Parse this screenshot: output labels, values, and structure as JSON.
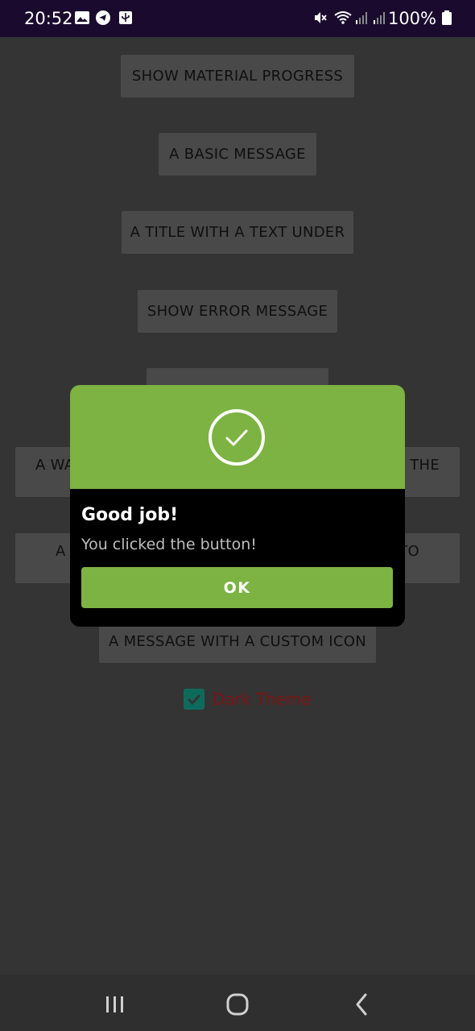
{
  "status_bar": {
    "time": "20:52",
    "battery": "100%",
    "icons": [
      "image-icon",
      "telegram-icon",
      "usb-icon",
      "mute-icon",
      "wifi-icon",
      "signal-icon",
      "signal-icon",
      "battery-icon"
    ]
  },
  "buttons": {
    "material_progress": "SHOW MATERIAL PROGRESS",
    "basic_message": "A BASIC MESSAGE",
    "title_text_under": "A TITLE WITH A TEXT UNDER",
    "error_message": "SHOW ERROR MESSAGE",
    "warning_left": "A WA",
    "warning_right": "THE",
    "confirm_left": "A",
    "confirm_right": "TO",
    "custom_icon": "A MESSAGE WITH A CUSTOM ICON"
  },
  "checkbox": {
    "label": "Dark Theme",
    "checked": true
  },
  "dialog": {
    "title": "Good job!",
    "message": "You clicked the button!",
    "ok_label": "OK",
    "icon": "success-check-icon"
  },
  "colors": {
    "accent_green": "#7cb342",
    "status_bar": "#1a0b2e",
    "checkbox": "#0d6b5c",
    "checkbox_label": "#7a1414"
  }
}
